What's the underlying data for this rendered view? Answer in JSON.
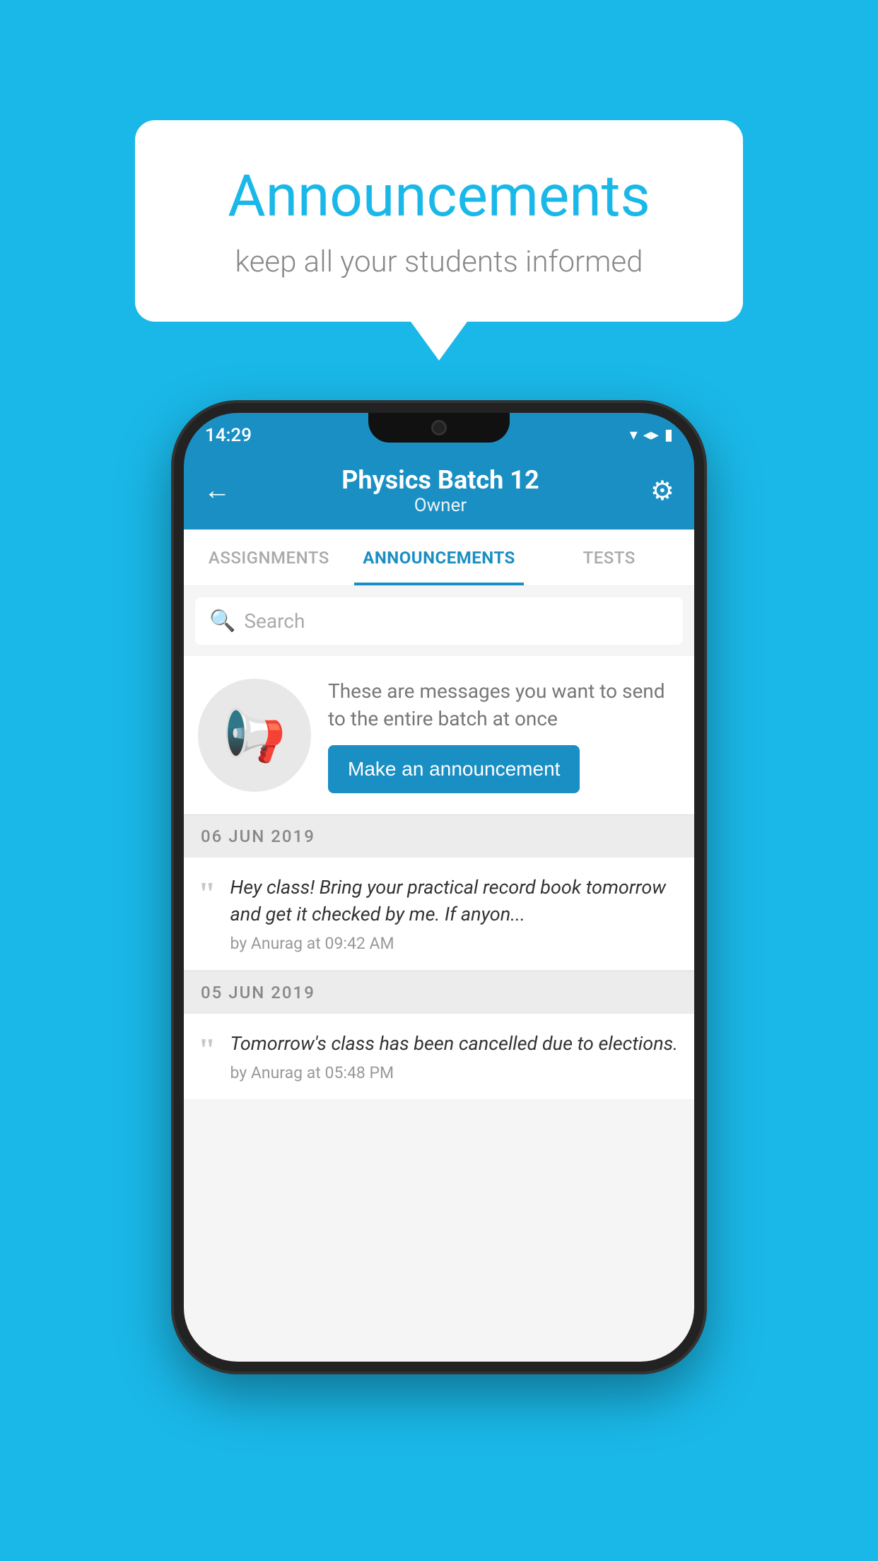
{
  "background_color": "#1ab8e8",
  "speech_bubble": {
    "title": "Announcements",
    "subtitle": "keep all your students informed"
  },
  "status_bar": {
    "time": "14:29",
    "wifi_icon": "▼",
    "signal_icon": "▲",
    "battery_icon": "▮"
  },
  "header": {
    "title": "Physics Batch 12",
    "subtitle": "Owner",
    "back_icon": "←",
    "gear_icon": "⚙"
  },
  "tabs": [
    {
      "label": "ASSIGNMENTS",
      "active": false
    },
    {
      "label": "ANNOUNCEMENTS",
      "active": true
    },
    {
      "label": "TESTS",
      "active": false
    }
  ],
  "search": {
    "placeholder": "Search"
  },
  "promo": {
    "description": "These are messages you want to send to the entire batch at once",
    "button_label": "Make an announcement"
  },
  "announcements": [
    {
      "date": "06  JUN  2019",
      "text": "Hey class! Bring your practical record book tomorrow and get it checked by me. If anyon...",
      "meta": "by Anurag at 09:42 AM"
    },
    {
      "date": "05  JUN  2019",
      "text": "Tomorrow's class has been cancelled due to elections.",
      "meta": "by Anurag at 05:48 PM"
    }
  ]
}
